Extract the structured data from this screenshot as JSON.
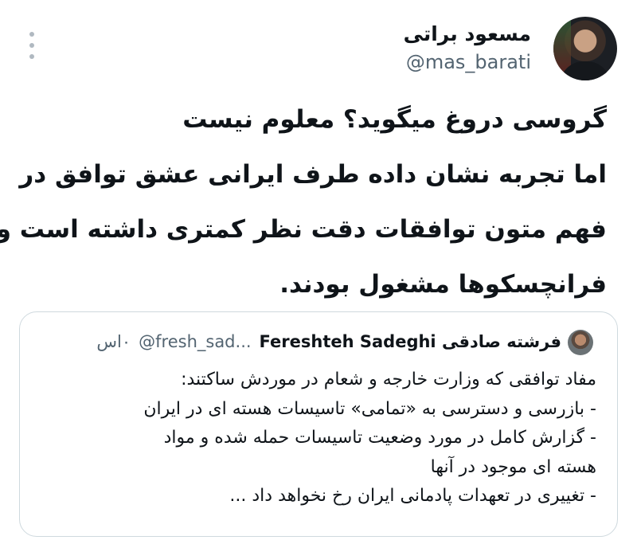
{
  "author": {
    "display_name": "مسعود براتی",
    "handle": "@mas_barati"
  },
  "tweet_lines": [
    "گروسی دروغ میگوید؟ معلوم نیست",
    "اما تجربه نشان داده طرف ایرانی عشق توافق در",
    "فهم متون توافقات دقت نظر کمتری داشته است و",
    "فرانچسکوها مشغول بودند."
  ],
  "quote": {
    "display_name": "فرشته صادقی Fereshteh Sadeghi",
    "handle": "@fresh_sad...",
    "time": "۰اس",
    "lines": [
      "مفاد توافقی که وزارت خارجه و شعام در موردش ساکتند:",
      "- بازرسی و دسترسی به «تمامی» تاسیسات هسته ای در ایران",
      "- گزارش کامل در مورد وضعیت تاسیسات حمله شده و مواد",
      "هسته ای موجود در آنها",
      "- تغییری در تعهدات پادمانی ایران رخ نخواهد داد ..."
    ]
  },
  "icons": {
    "more": "more-vertical-icon"
  }
}
